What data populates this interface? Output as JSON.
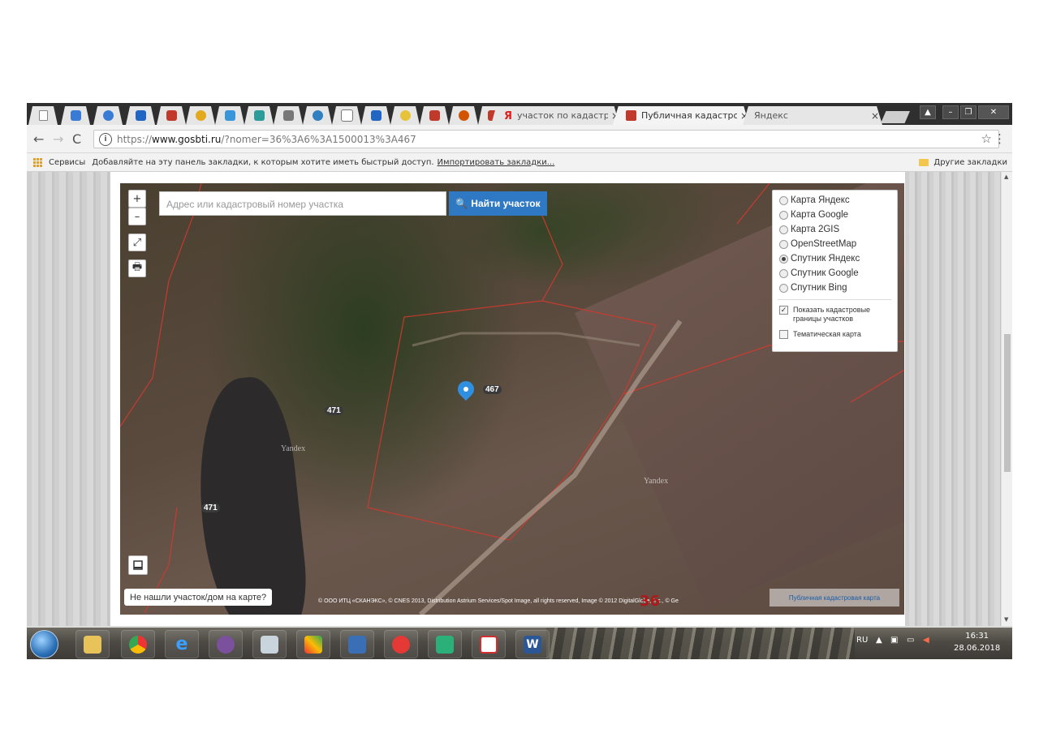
{
  "browser": {
    "tabs": [
      {
        "title": "участок по кадастров",
        "favicon": "yandex-icon"
      },
      {
        "title": "Публичная кадастров",
        "favicon": "rosreestr-icon",
        "active": true
      },
      {
        "title": "Яндекс",
        "favicon": "none"
      }
    ],
    "close_glyph": "×",
    "url": "https://www.gosbti.ru/?nomer=36%3A6%3A1500013%3A467",
    "url_prefix": "https://",
    "url_domain": "www.gosbti.ru",
    "url_path": "/?nomer=36%3A6%3A1500013%3A467",
    "bookmarks": {
      "apps_label": "Сервисы",
      "hint": "Добавляйте на эту панель закладки, к которым хотите иметь быстрый доступ.",
      "import_link": "Импортировать закладки...",
      "other": "Другие закладки"
    }
  },
  "map": {
    "search_placeholder": "Адрес или кадастровый номер участка",
    "search_button": "Найти участок",
    "layers": [
      {
        "label": "Карта Яндекс",
        "selected": false
      },
      {
        "label": "Карта Google",
        "selected": false
      },
      {
        "label": "Карта 2GIS",
        "selected": false
      },
      {
        "label": "OpenStreetMap",
        "selected": false
      },
      {
        "label": "Спутник Яндекс",
        "selected": true
      },
      {
        "label": "Спутник Google",
        "selected": false
      },
      {
        "label": "Спутник Bing",
        "selected": false
      }
    ],
    "options": [
      {
        "label": "Показать кадастровые границы участков",
        "checked": true
      },
      {
        "label": "Тематическая карта",
        "checked": false
      }
    ],
    "plot_labels": [
      "467",
      "471",
      "471"
    ],
    "watermark": "Yandex",
    "not_found_button": "Не нашли участок/дом на карте?",
    "copyright": "© ООО ИТЦ «СКАНЭКС», © CNES 2013, Distribution Astrium Services/Spot Image, all rights reserved, Image © 2012 DigitalGlobe, Inc., © Ge",
    "pkk_link": "Публичная кадастровая карта",
    "region_number": "36"
  },
  "taskbar": {
    "apps": [
      "explorer-icon",
      "chrome-icon",
      "ie-icon",
      "viber-icon",
      "scanner-icon",
      "paint-icon",
      "network-icon",
      "antivirus-icon",
      "phone-icon",
      "pdf-icon",
      "word-icon"
    ],
    "language": "RU",
    "time": "16:31",
    "date": "28.06.2018"
  },
  "colors": {
    "search_button": "#2f79c4",
    "cadastral_line": "#c0392b",
    "pin": "#2f8fe0"
  }
}
